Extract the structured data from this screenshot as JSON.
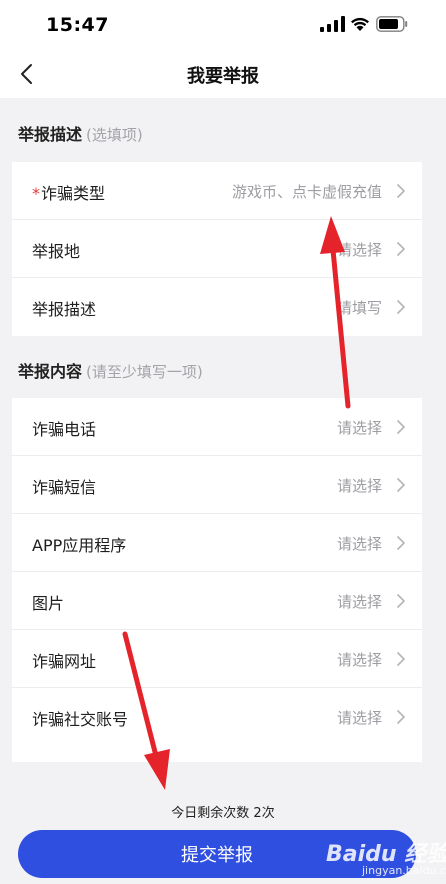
{
  "status_bar": {
    "time": "15:47",
    "icons": [
      "signal-icon",
      "wifi-icon",
      "battery-icon"
    ]
  },
  "nav": {
    "title": "我要举报",
    "back_icon": "chevron-left-icon"
  },
  "section_description": {
    "title": "举报描述",
    "hint": "(选填项)",
    "rows": [
      {
        "label": "诈骗类型",
        "required": "*",
        "value": "游戏币、点卡虚假充值"
      },
      {
        "label": "举报地",
        "value": "请选择"
      },
      {
        "label": "举报描述",
        "value": "请填写"
      }
    ]
  },
  "section_content": {
    "title": "举报内容",
    "hint": "(请至少填写一项)",
    "rows": [
      {
        "label": "诈骗电话",
        "value": "请选择"
      },
      {
        "label": "诈骗短信",
        "value": "请选择"
      },
      {
        "label": "APP应用程序",
        "value": "请选择"
      },
      {
        "label": "图片",
        "value": "请选择"
      },
      {
        "label": "诈骗网址",
        "value": "请选择"
      },
      {
        "label": "诈骗社交账号",
        "value": "请选择"
      }
    ]
  },
  "footer": {
    "remaining": "今日剩余次数 2次",
    "submit_label": "提交举报"
  },
  "watermark": {
    "main": "Baidu 经验",
    "sub": "jingyan.baidu.com"
  },
  "colors": {
    "accent": "#2f4fe0",
    "required": "#e23a3a",
    "annotation": "#e5232b",
    "background": "#f2f2f4"
  }
}
